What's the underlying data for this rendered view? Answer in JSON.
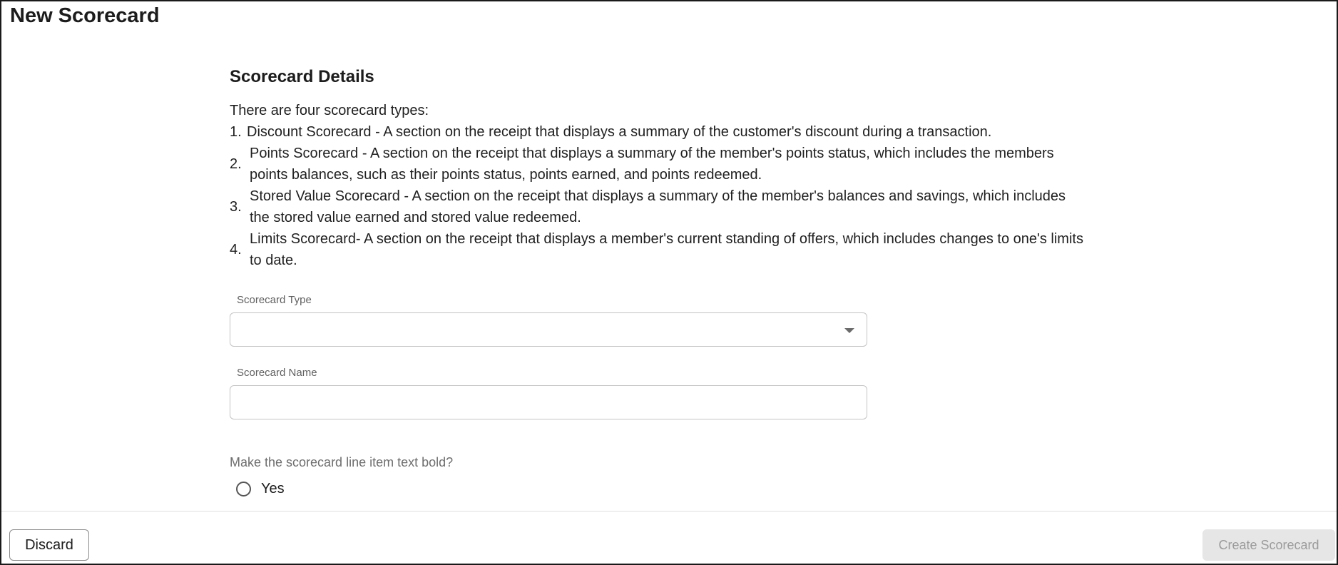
{
  "page": {
    "title": "New Scorecard"
  },
  "details": {
    "heading": "Scorecard Details",
    "intro": "There are four scorecard types:",
    "types": [
      {
        "number": "1.",
        "text": "Discount Scorecard - A section on the receipt that displays a summary of the customer's discount during a transaction."
      },
      {
        "number": "2.",
        "text": "Points Scorecard - A section on the receipt that displays a summary of the member's points status, which includes the members points balances, such as their points status, points earned, and points redeemed."
      },
      {
        "number": "3.",
        "text": "Stored Value Scorecard - A section on the receipt that displays a summary of the member's balances and savings, which includes the stored value earned and stored value redeemed."
      },
      {
        "number": "4.",
        "text": "Limits Scorecard- A section on the receipt that displays a member's current standing of offers, which includes changes to one's limits to date."
      }
    ]
  },
  "form": {
    "scorecard_type": {
      "label": "Scorecard Type",
      "value": "",
      "icon": "chevron-down-icon"
    },
    "scorecard_name": {
      "label": "Scorecard Name",
      "value": ""
    },
    "bold_question": {
      "label": "Make the scorecard line item text bold?",
      "option_yes": "Yes",
      "selected": false
    }
  },
  "footer": {
    "discard_label": "Discard",
    "create_label": "Create Scorecard",
    "create_disabled": true
  },
  "colors": {
    "disabled_button_bg": "#e6e6e6",
    "disabled_button_text": "#9b9b9b",
    "field_border": "#c4c4c4"
  }
}
